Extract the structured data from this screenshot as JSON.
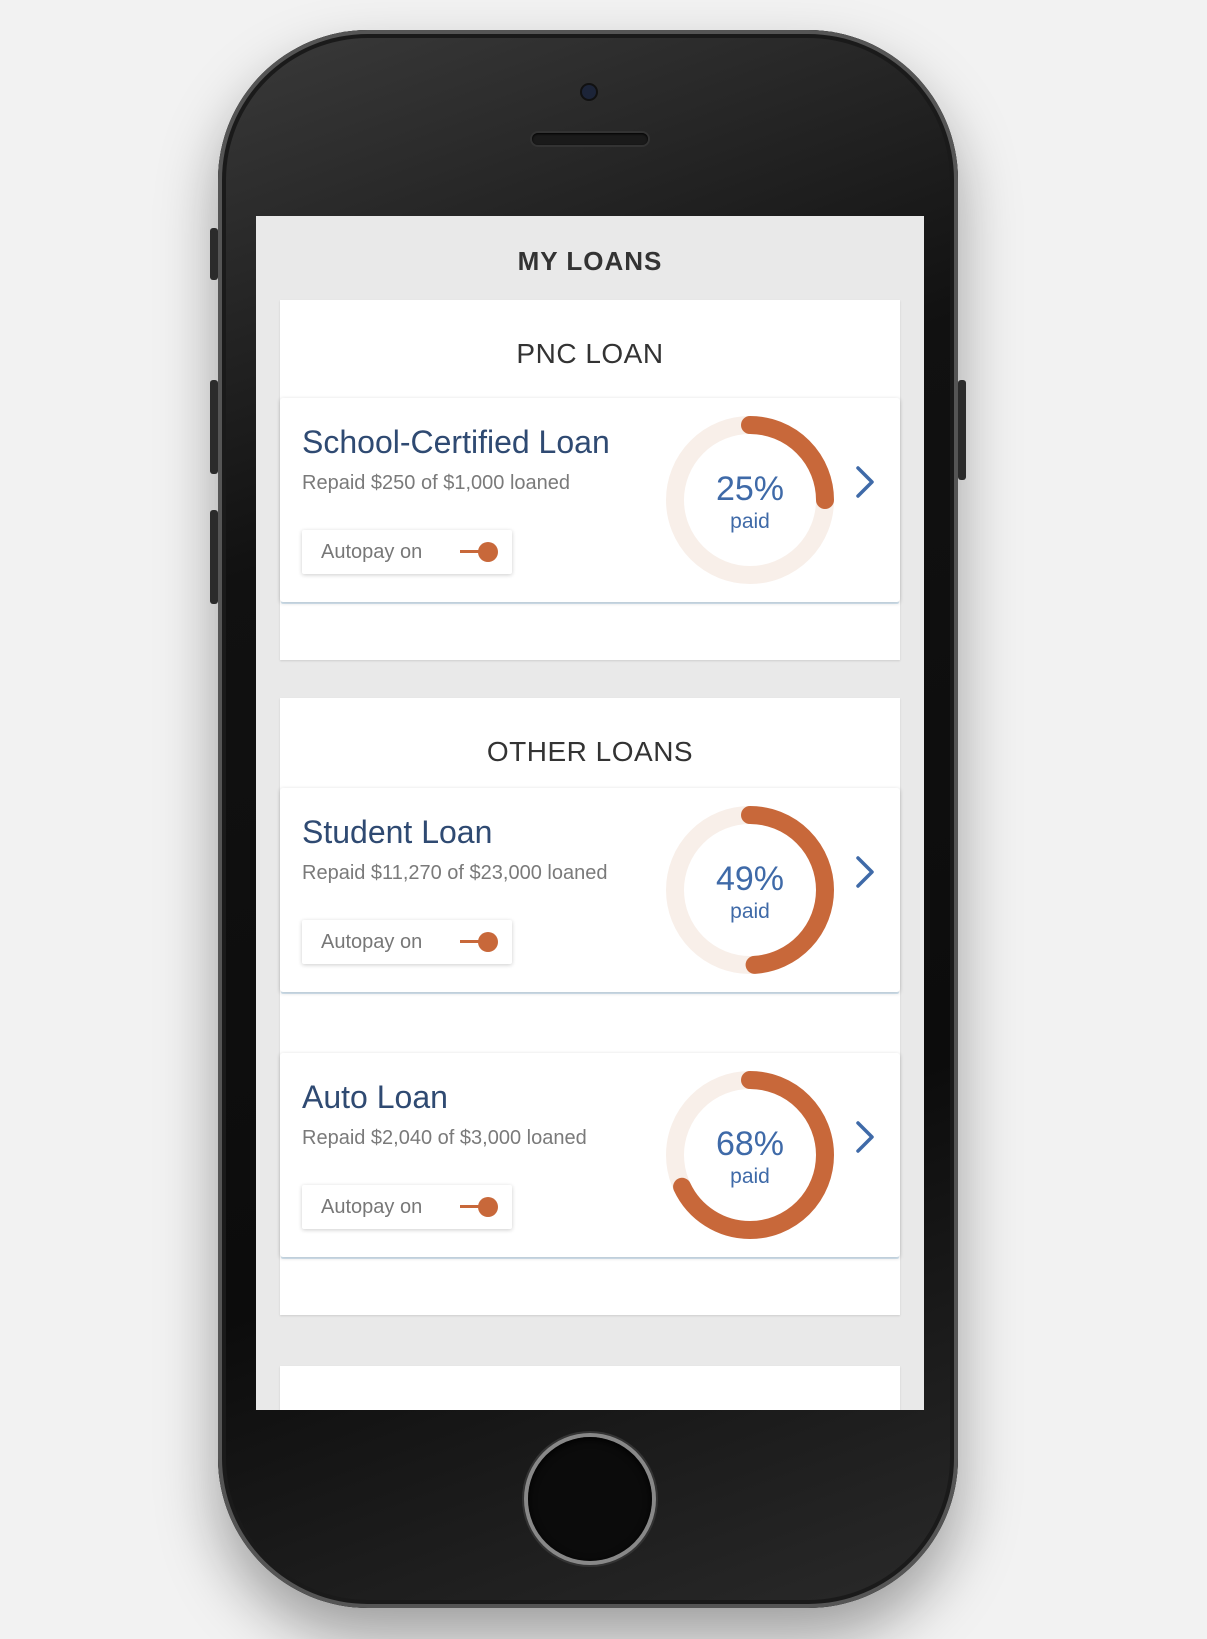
{
  "screen": {
    "title": "MY LOANS"
  },
  "sections": {
    "pnc": {
      "title": "PNC LOAN"
    },
    "other": {
      "title": "OTHER LOANS"
    }
  },
  "loans": [
    {
      "name": "School-Certified Loan",
      "summary": "Repaid $250 of $1,000 loaned",
      "autopay_label": "Autopay on",
      "autopay_on": true,
      "percent_text": "25%",
      "percent_paid": 0.25,
      "paid_label": "paid"
    },
    {
      "name": "Student Loan",
      "summary": "Repaid $11,270 of $23,000 loaned",
      "autopay_label": "Autopay on",
      "autopay_on": true,
      "percent_text": "49%",
      "percent_paid": 0.49,
      "paid_label": "paid"
    },
    {
      "name": "Auto Loan",
      "summary": "Repaid $2,040 of $3,000 loaned",
      "autopay_label": "Autopay on",
      "autopay_on": true,
      "percent_text": "68%",
      "percent_paid": 0.68,
      "paid_label": "paid"
    }
  ],
  "icons": {
    "detail": "chevron-right-icon"
  },
  "colors": {
    "accent": "#c8683a",
    "ring_track": "#f8efe9",
    "link_blue": "#3f6aa8",
    "title_navy": "#2f4a72"
  }
}
